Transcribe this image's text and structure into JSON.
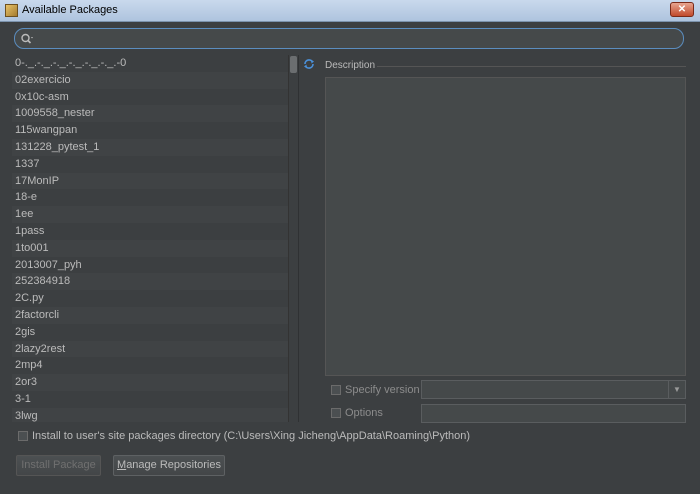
{
  "window": {
    "title": "Available Packages",
    "close_glyph": "✕"
  },
  "search": {
    "value": "",
    "placeholder": ""
  },
  "packages": [
    "0-._.-._.-._.-._.-._.-._.-0",
    "02exercicio",
    "0x10c-asm",
    "1009558_nester",
    "115wangpan",
    "131228_pytest_1",
    "1337",
    "17MonIP",
    "18-e",
    "1ee",
    "1pass",
    "1to001",
    "2013007_pyh",
    "252384918",
    "2C.py",
    "2factorcli",
    "2gis",
    "2lazy2rest",
    "2mp4",
    "2or3",
    "3-1",
    "3lwg"
  ],
  "description": {
    "label": "Description",
    "text": ""
  },
  "specify_version": {
    "label": "Specify version",
    "checked": false,
    "value": ""
  },
  "options": {
    "label": "Options",
    "checked": false,
    "value": ""
  },
  "install_user": {
    "label": "Install to user's site packages directory (C:\\Users\\Xing Jicheng\\AppData\\Roaming\\Python)",
    "checked": false
  },
  "buttons": {
    "install": "Install Package",
    "manage_prefix": "",
    "manage_mnemonic": "M",
    "manage_rest": "anage Repositories"
  },
  "icons": {
    "search": "search-icon",
    "refresh": "refresh-icon",
    "window": "pycharm-icon",
    "close": "close-icon",
    "dropdown": "chevron-down-icon"
  },
  "colors": {
    "background": "#3c3f41",
    "accent": "#5b8dbf",
    "text": "#bbbbbb"
  }
}
